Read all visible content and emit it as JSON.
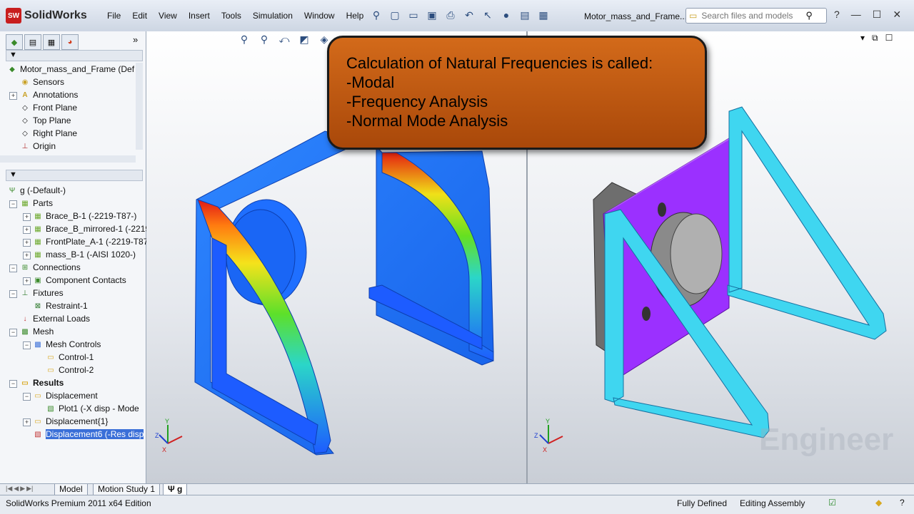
{
  "app": {
    "name": "SolidWorks",
    "logo_badge": "SW"
  },
  "menu": [
    "File",
    "Edit",
    "View",
    "Insert",
    "Tools",
    "Simulation",
    "Window",
    "Help"
  ],
  "document_title": "Motor_mass_and_Frame....",
  "search": {
    "placeholder": "Search files and models"
  },
  "feature_tree_top": {
    "root": "Motor_mass_and_Frame  (Def",
    "items": [
      "Sensors",
      "Annotations",
      "Front Plane",
      "Top Plane",
      "Right Plane",
      "Origin"
    ]
  },
  "simulation_tree": {
    "root": "g (-Default-)",
    "parts_label": "Parts",
    "parts": [
      "Brace_B-1 (-2219-T87-)",
      "Brace_B_mirrored-1 (-2219",
      "FrontPlate_A-1 (-2219-T87",
      "mass_B-1 (-AISI 1020-)"
    ],
    "connections_label": "Connections",
    "component_contacts": "Component Contacts",
    "fixtures_label": "Fixtures",
    "restraint": "Restraint-1",
    "external_loads": "External Loads",
    "mesh_label": "Mesh",
    "mesh_controls": "Mesh Controls",
    "controls": [
      "Control-1",
      "Control-2"
    ],
    "results_label": "Results",
    "displacement": "Displacement",
    "plot1": "Plot1 (-X disp - Mode",
    "displacement1": "Displacement{1}",
    "displacement6": "Displacement6 (-Res disp"
  },
  "callout": {
    "lines": [
      "Calculation of Natural Frequencies is called:",
      "-Modal",
      "-Frequency Analysis",
      "-Normal Mode Analysis"
    ]
  },
  "watermark": "Engineer",
  "bottom_tabs": [
    "Model",
    "Motion Study 1",
    "g"
  ],
  "status": {
    "edition": "SolidWorks Premium 2011 x64 Edition",
    "state": "Fully Defined",
    "mode": "Editing Assembly"
  },
  "colors": {
    "callout_fill": "#c45c12",
    "plate_left": "#1e7bff",
    "plate_right": "#9b30ff",
    "frame_right": "#3fd6f0",
    "selection": "#3a6fd8"
  }
}
